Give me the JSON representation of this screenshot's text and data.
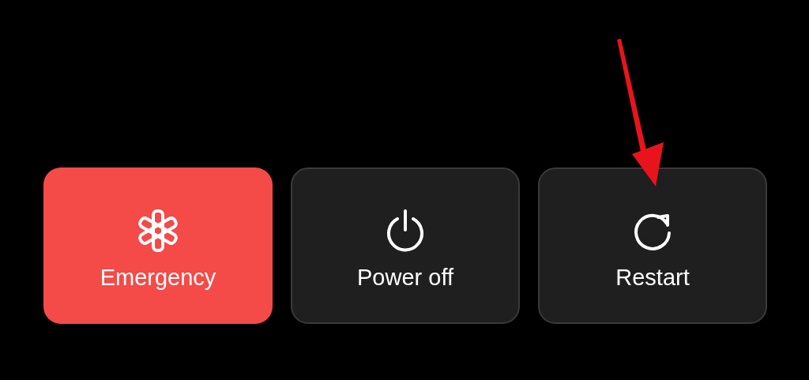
{
  "buttons": [
    {
      "kind": "emergency",
      "label": "Emergency",
      "color": "#f44a48"
    },
    {
      "kind": "power",
      "label": "Power off",
      "color": "#1f1f20"
    },
    {
      "kind": "restart",
      "label": "Restart",
      "color": "#1f1f20"
    }
  ]
}
